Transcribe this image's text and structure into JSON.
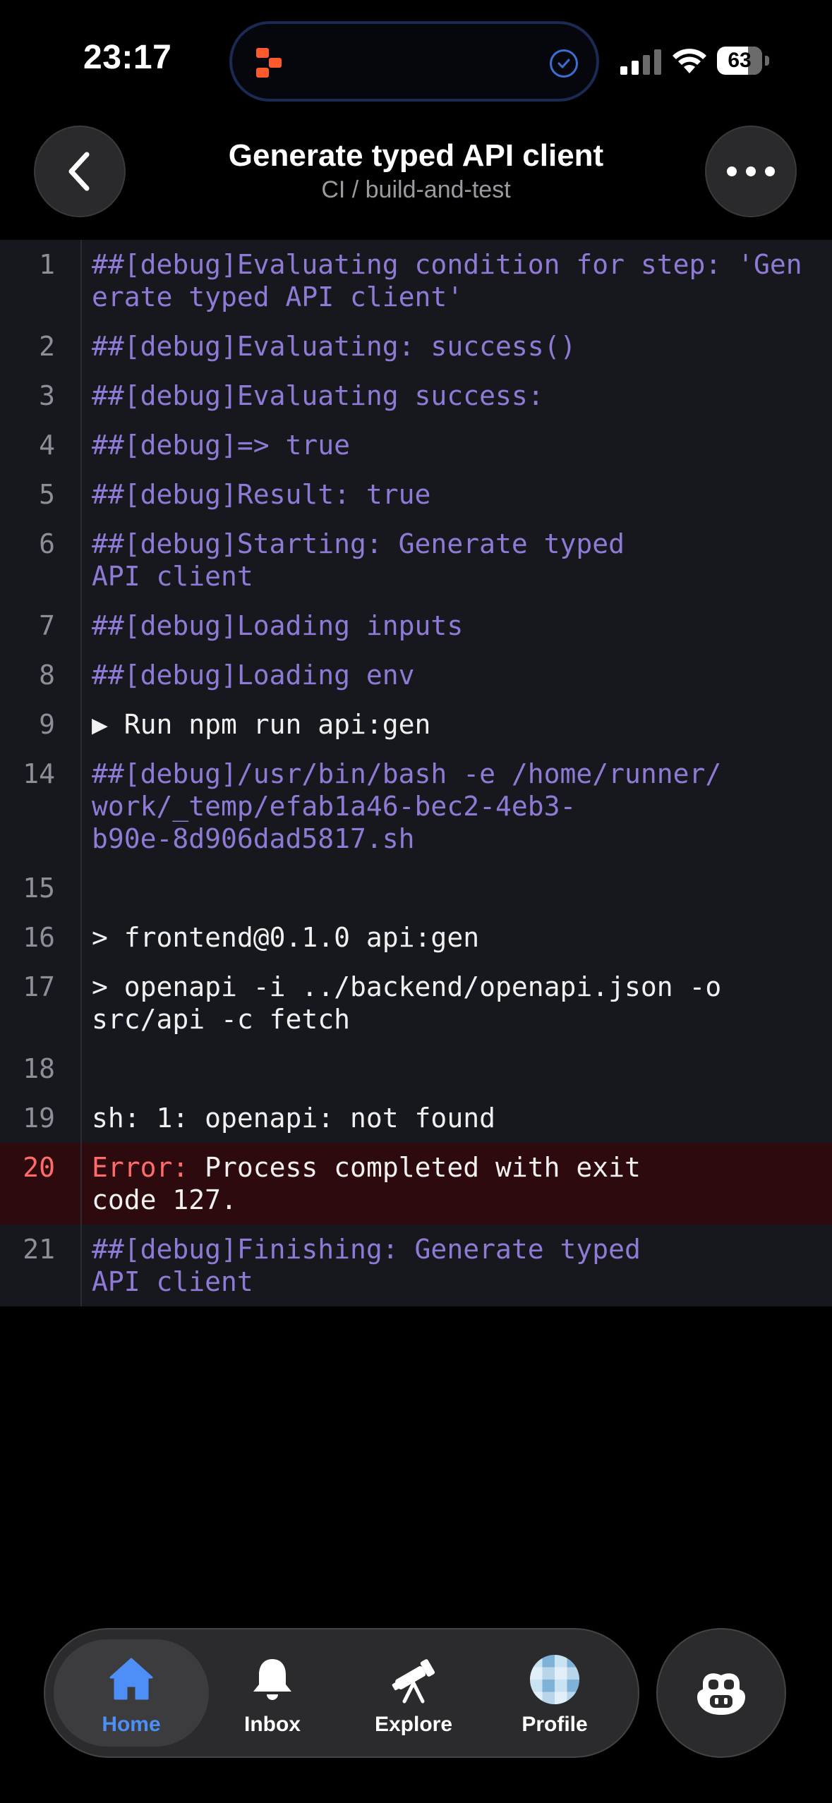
{
  "status_bar": {
    "time": "23:17",
    "battery": "63"
  },
  "header": {
    "title": "Generate typed API client",
    "subtitle": "CI / build-and-test"
  },
  "log": {
    "lines": [
      {
        "num": "1",
        "kind": "debug",
        "text": "##[debug]Evaluating condition for step: 'Generate typed API client'"
      },
      {
        "num": "2",
        "kind": "debug",
        "text": "##[debug]Evaluating: success()"
      },
      {
        "num": "3",
        "kind": "debug",
        "text": "##[debug]Evaluating success:"
      },
      {
        "num": "4",
        "kind": "debug",
        "text": "##[debug]=> true"
      },
      {
        "num": "5",
        "kind": "debug",
        "text": "##[debug]Result: true"
      },
      {
        "num": "6",
        "kind": "debug",
        "text": "##[debug]Starting: Generate typed\nAPI client"
      },
      {
        "num": "7",
        "kind": "debug",
        "text": "##[debug]Loading inputs"
      },
      {
        "num": "8",
        "kind": "debug",
        "text": "##[debug]Loading env"
      },
      {
        "num": "9",
        "kind": "plain",
        "text": "▶ Run npm run api:gen"
      },
      {
        "num": "14",
        "kind": "debug",
        "text": "##[debug]/usr/bin/bash -e /home/runner/\nwork/_temp/efab1a46-bec2-4eb3-\nb90e-8d906dad5817.sh"
      },
      {
        "num": "15",
        "kind": "plain",
        "text": " "
      },
      {
        "num": "16",
        "kind": "plain",
        "text": "> frontend@0.1.0 api:gen"
      },
      {
        "num": "17",
        "kind": "plain",
        "text": "> openapi -i ../backend/openapi.json -o\nsrc/api -c fetch"
      },
      {
        "num": "18",
        "kind": "plain",
        "text": " "
      },
      {
        "num": "19",
        "kind": "plain",
        "text": "sh: 1: openapi: not found"
      },
      {
        "num": "20",
        "kind": "error",
        "label": "Error:",
        "text": " Process completed with exit\ncode 127."
      },
      {
        "num": "21",
        "kind": "debug",
        "text": "##[debug]Finishing: Generate typed\nAPI client"
      }
    ]
  },
  "tabbar": {
    "home": "Home",
    "inbox": "Inbox",
    "explore": "Explore",
    "profile": "Profile"
  },
  "colors": {
    "debug": "#8f7ad6",
    "error": "#ff6b6b",
    "active_tab": "#4d8ff7",
    "log_bg": "#16181d",
    "error_row_bg": "#2d0a0d"
  }
}
